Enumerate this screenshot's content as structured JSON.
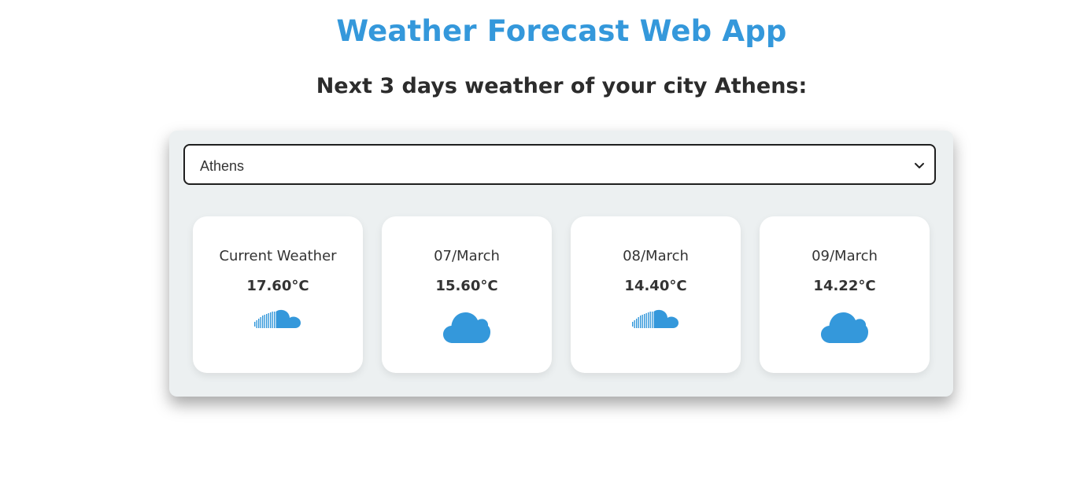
{
  "header": {
    "title": "Weather Forecast Web App",
    "subtitle": "Next 3 days weather of your city Athens:"
  },
  "city_select": {
    "selected": "Athens"
  },
  "accent_color": "#3498db",
  "forecast": [
    {
      "label": "Current Weather",
      "temp": "17.60°C",
      "icon": "soundcloud-cloud-icon"
    },
    {
      "label": "07/March",
      "temp": "15.60°C",
      "icon": "cloud-icon"
    },
    {
      "label": "08/March",
      "temp": "14.40°C",
      "icon": "soundcloud-cloud-icon"
    },
    {
      "label": "09/March",
      "temp": "14.22°C",
      "icon": "cloud-icon"
    }
  ]
}
